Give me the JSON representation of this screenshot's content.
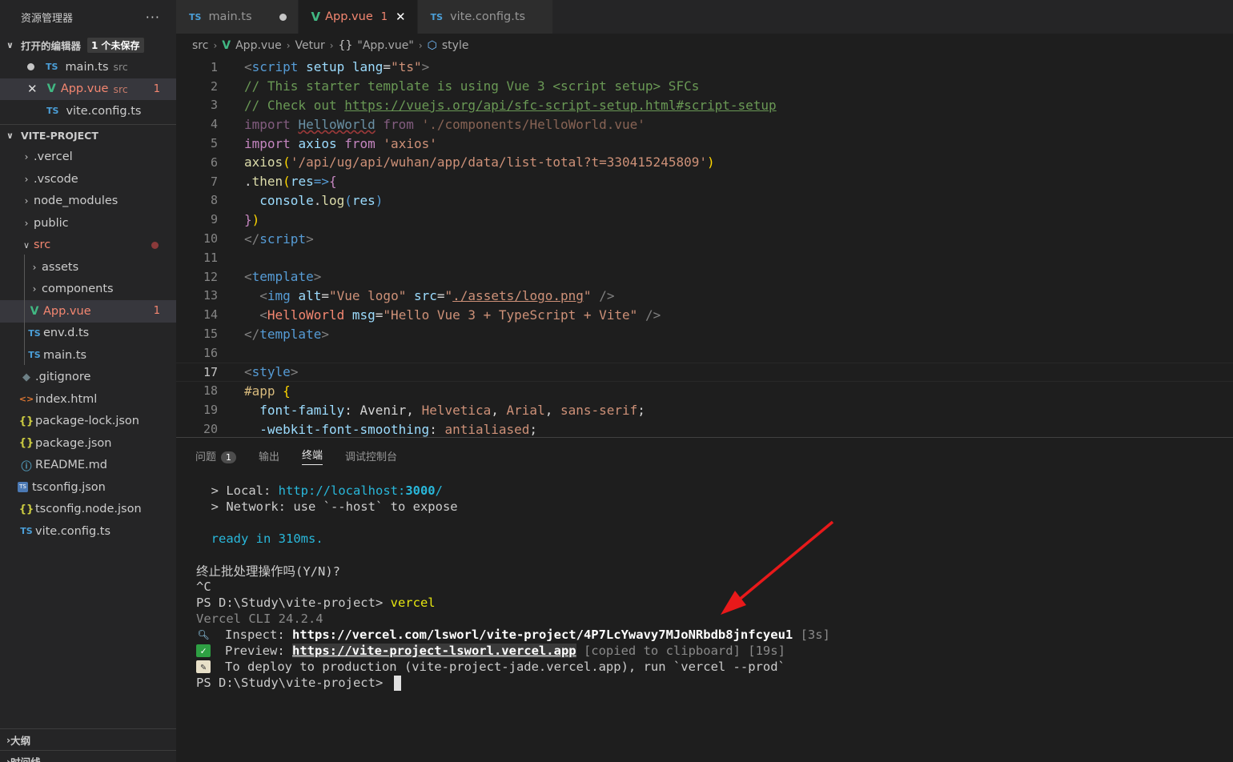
{
  "sidebar": {
    "title": "资源管理器",
    "more": "···",
    "open_editors": {
      "label": "打开的编辑器",
      "badge": "1 个未保存",
      "items": [
        {
          "icon": "TS",
          "name": "main.ts",
          "path": "src",
          "state": "modified"
        },
        {
          "icon": "V",
          "name": "App.vue",
          "path": "src",
          "problems": "1",
          "state": "active"
        },
        {
          "icon": "TS",
          "name": "vite.config.ts",
          "path": ""
        }
      ]
    },
    "project": {
      "label": "VITE-PROJECT",
      "items": [
        {
          "name": ".vercel"
        },
        {
          "name": ".vscode"
        },
        {
          "name": "node_modules"
        },
        {
          "name": "public"
        },
        {
          "name": "src"
        },
        {
          "name": "assets"
        },
        {
          "name": "components"
        },
        {
          "name": "App.vue",
          "problems": "1"
        },
        {
          "name": "env.d.ts"
        },
        {
          "name": "main.ts"
        },
        {
          "name": ".gitignore"
        },
        {
          "name": "index.html"
        },
        {
          "name": "package-lock.json"
        },
        {
          "name": "package.json"
        },
        {
          "name": "README.md"
        },
        {
          "name": "tsconfig.json"
        },
        {
          "name": "tsconfig.node.json"
        },
        {
          "name": "vite.config.ts"
        }
      ]
    },
    "outline_label": "大纲",
    "timeline_label": "时间线"
  },
  "tabs": [
    {
      "icon": "TS",
      "label": "main.ts"
    },
    {
      "icon": "V",
      "label": "App.vue",
      "problems": "1"
    },
    {
      "icon": "TS",
      "label": "vite.config.ts"
    }
  ],
  "breadcrumb": {
    "src": "src",
    "file": "App.vue",
    "vetur": "Vetur",
    "braces": "{}",
    "component": "\"App.vue\"",
    "style": "style"
  },
  "editor": {
    "line_numbers": [
      "1",
      "2",
      "3",
      "4",
      "5",
      "6",
      "7",
      "8",
      "9",
      "10",
      "11",
      "12",
      "13",
      "14",
      "15",
      "16",
      "17",
      "18",
      "19",
      "20"
    ],
    "current_line": "17"
  },
  "panel": {
    "tabs": {
      "problems": "问题",
      "problems_count": "1",
      "output": "输出",
      "terminal": "终端",
      "debug": "调试控制台"
    },
    "terminal": {
      "local_label": "Local:",
      "local_url_prefix": "http://localhost:",
      "local_port": "3000",
      "local_slash": "/",
      "network_line": "Network: use `--host` to expose",
      "ready": "ready in 310ms.",
      "terminate": "终止批处理操作吗(Y/N)?",
      "ctrl_c": "^C",
      "prompt1": "PS D:\\Study\\vite-project> ",
      "cmd": "vercel",
      "cli_version": "Vercel CLI 24.2.4",
      "inspect_label": "Inspect: ",
      "inspect_url": "https://vercel.com/lsworl/vite-project/4P7LcYwavy7MJoNRbdb8jnfcyeu1",
      "inspect_time": " [3s]",
      "preview_label": "Preview: ",
      "preview_url": "https://vite-project-lsworl.vercel.app",
      "preview_note": " [copied to clipboard] [19s]",
      "deploy_text": "To deploy to production (vite-project-jade.vercel.app), run `vercel --prod`",
      "prompt2": "PS D:\\Study\\vite-project> "
    }
  },
  "colors": {
    "editor_bg": "#1e1e1e",
    "sidebar_bg": "#252526",
    "arrow": "#e8191a",
    "vue_green": "#41b883",
    "error_red": "#f48771"
  }
}
